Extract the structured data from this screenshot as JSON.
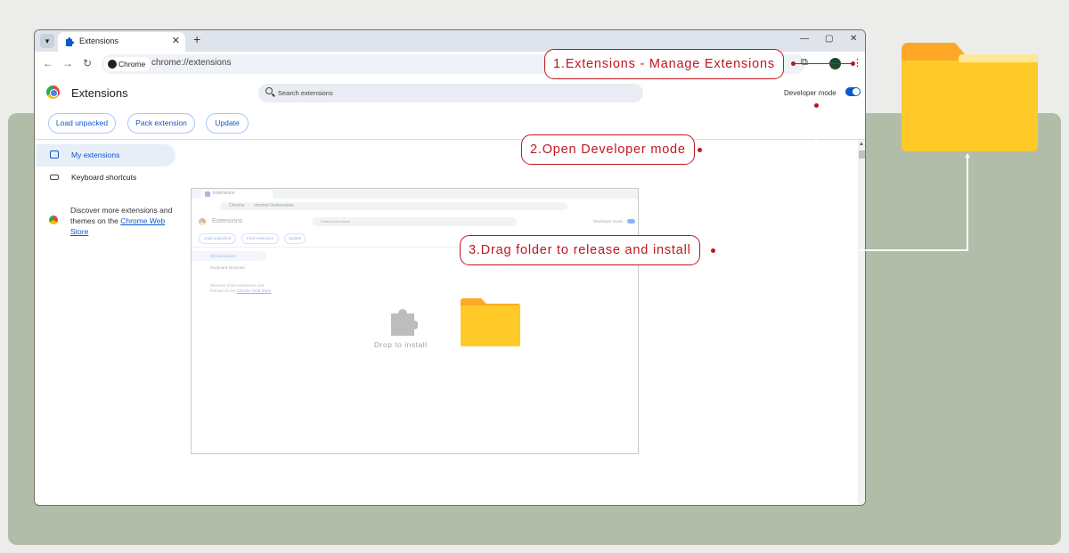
{
  "browser": {
    "tab_title": "Extensions",
    "tab_close": "✕",
    "new_tab": "+",
    "minimize": "—",
    "maximize": "▢",
    "close": "✕",
    "chip_label": "Chrome",
    "url": "chrome://extensions"
  },
  "page": {
    "title": "Extensions",
    "search_placeholder": "Search extensions",
    "developer_mode_label": "Developer mode",
    "developer_mode_on": true,
    "buttons": [
      "Load unpacked",
      "Pack extension",
      "Update"
    ]
  },
  "sidebar": {
    "items": [
      "My extensions",
      "Keyboard shortcuts"
    ],
    "discover_text": "Discover more extensions and themes on the ",
    "discover_link": "Chrome Web Store"
  },
  "mini": {
    "tab_title": "Extensions",
    "url": "chrome://extensions",
    "chip": "Chrome",
    "title": "Extensions",
    "search_placeholder": "Search extensions",
    "developer_mode_label": "Developer mode",
    "buttons": [
      "Load unpacked",
      "Pack extension",
      "Update"
    ],
    "sidebar_items": [
      "My extensions",
      "Keyboard shortcuts"
    ],
    "discover_text": "Discover more extensions and themes on the ",
    "discover_link": "Chrome Web Store",
    "drop_text": "Drop to install"
  },
  "callouts": [
    "1.Extensions - Manage Extensions",
    "2.Open Developer mode",
    "3.Drag folder to release and install"
  ],
  "colors": {
    "accent": "#0b57d0",
    "callout_red": "#c0171e",
    "folder_yellow": "#ffca28",
    "backdrop": "#b1bca9"
  }
}
